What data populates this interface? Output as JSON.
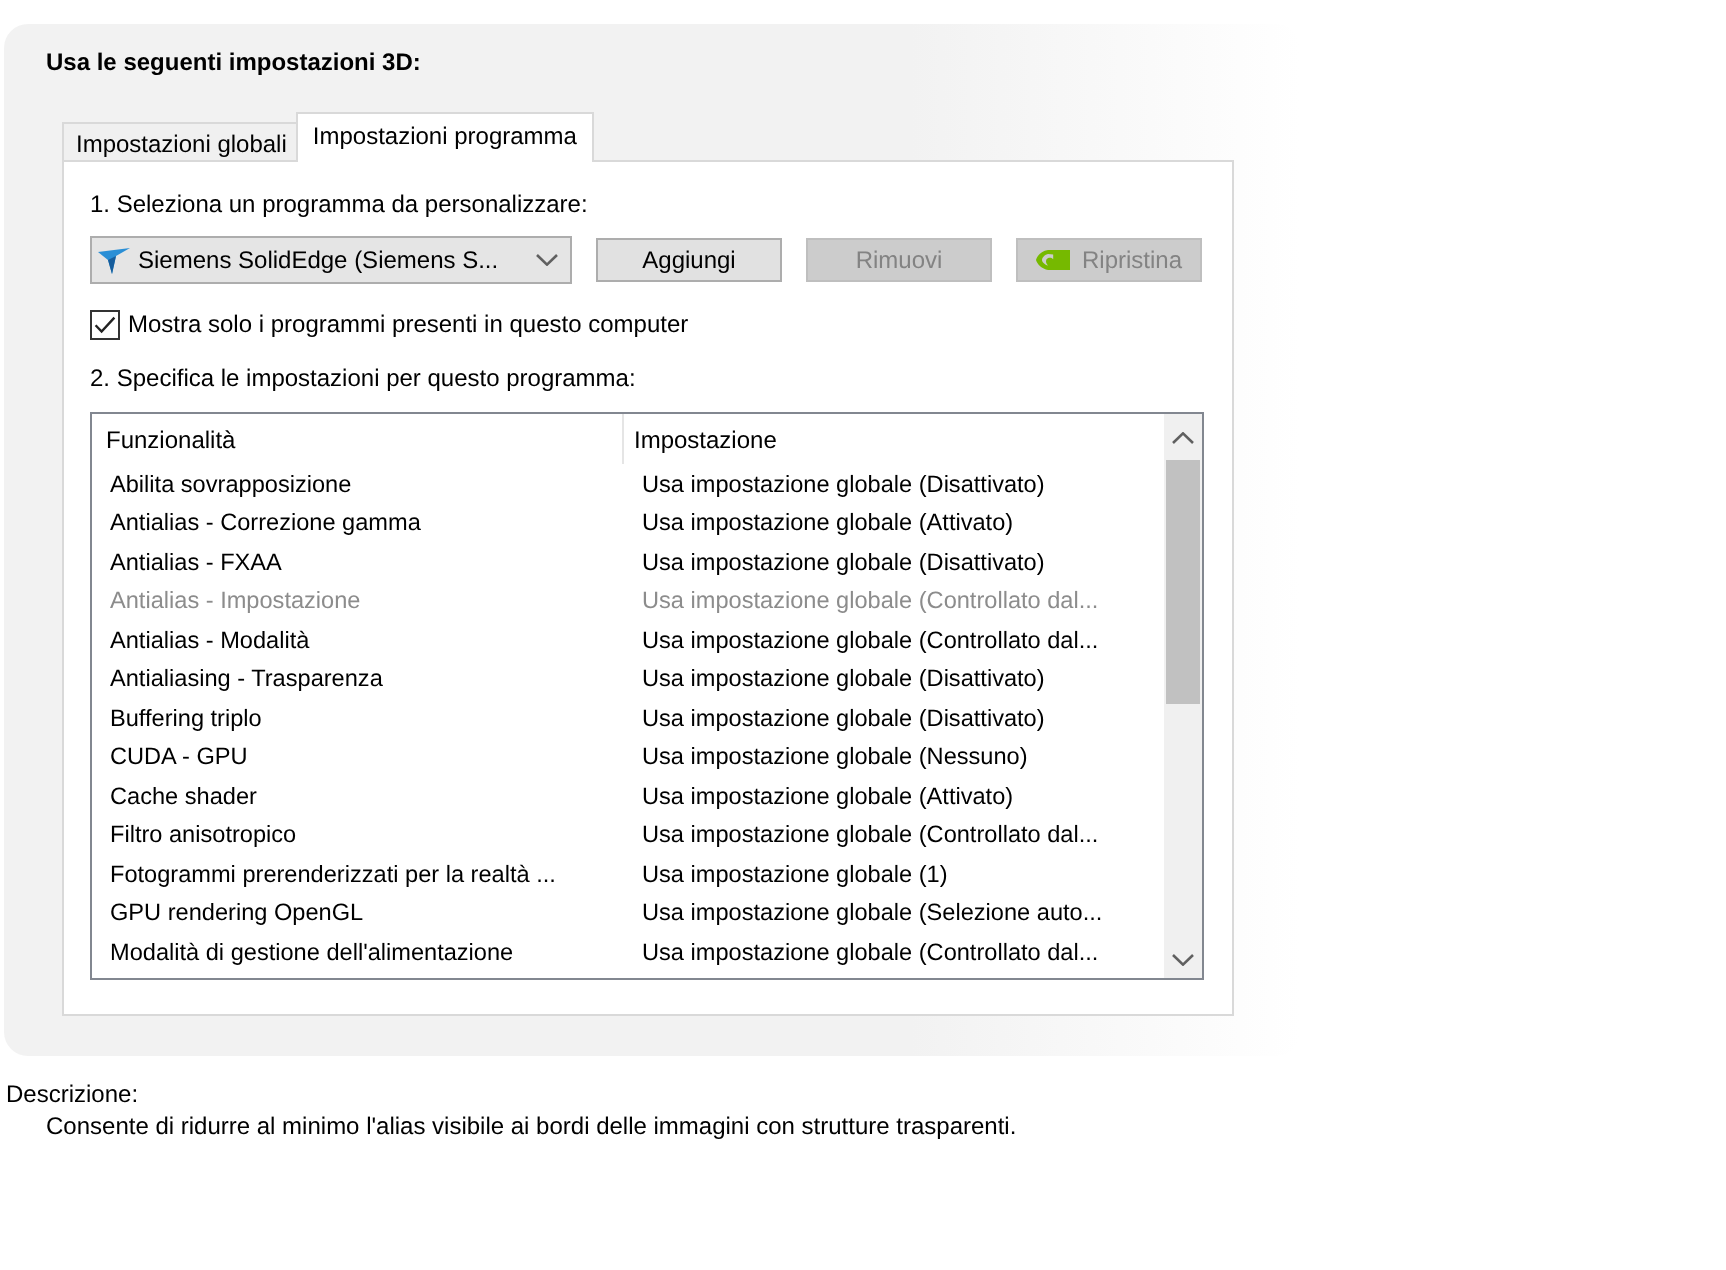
{
  "title": "Usa le seguenti impostazioni 3D:",
  "tabs": [
    {
      "label": "Impostazioni globali",
      "selected": false
    },
    {
      "label": "Impostazioni programma",
      "selected": true
    }
  ],
  "program_section": {
    "label": "1. Seleziona un programma da personalizzare:",
    "program_select": {
      "value": "Siemens SolidEdge (Siemens S..."
    },
    "buttons": [
      {
        "label": "Aggiungi",
        "disabled": false,
        "kind": "plain"
      },
      {
        "label": "Rimuovi",
        "disabled": true,
        "kind": "plain"
      },
      {
        "label": "Ripristina",
        "disabled": true,
        "kind": "logo"
      }
    ]
  },
  "show_only_installed": {
    "label": "Mostra solo i programmi presenti in questo computer",
    "checked": true
  },
  "settings_section": {
    "label": "2. Specifica le impostazioni per questo programma:",
    "table": {
      "columns": [
        "Funzionalità",
        "Impostazione"
      ],
      "rows": [
        {
          "feature": "Abilita sovrapposizione",
          "setting": "Usa impostazione globale (Disattivato)",
          "disabled": false
        },
        {
          "feature": "Antialias - Correzione gamma",
          "setting": "Usa impostazione globale (Attivato)",
          "disabled": false
        },
        {
          "feature": "Antialias - FXAA",
          "setting": "Usa impostazione globale (Disattivato)",
          "disabled": false
        },
        {
          "feature": "Antialias - Impostazione",
          "setting": "Usa impostazione globale (Controllato dal...",
          "disabled": true
        },
        {
          "feature": "Antialias - Modalità",
          "setting": "Usa impostazione globale (Controllato dal...",
          "disabled": false
        },
        {
          "feature": "Antialiasing - Trasparenza",
          "setting": "Usa impostazione globale (Disattivato)",
          "disabled": false
        },
        {
          "feature": "Buffering triplo",
          "setting": "Usa impostazione globale (Disattivato)",
          "disabled": false
        },
        {
          "feature": "CUDA - GPU",
          "setting": "Usa impostazione globale (Nessuno)",
          "disabled": false
        },
        {
          "feature": "Cache shader",
          "setting": "Usa impostazione globale (Attivato)",
          "disabled": false
        },
        {
          "feature": "Filtro anisotropico",
          "setting": "Usa impostazione globale (Controllato dal...",
          "disabled": false
        },
        {
          "feature": "Fotogrammi prerenderizzati per la realtà ...",
          "setting": "Usa impostazione globale (1)",
          "disabled": false
        },
        {
          "feature": "GPU rendering OpenGL",
          "setting": "Usa impostazione globale (Selezione auto...",
          "disabled": false
        },
        {
          "feature": "Modalità di gestione dell'alimentazione",
          "setting": "Usa impostazione globale (Controllato dal...",
          "disabled": false
        }
      ]
    }
  },
  "description": {
    "label": "Descrizione:",
    "text": "Consente di ridurre al minimo l'alias visibile ai bordi delle immagini con strutture trasparenti."
  }
}
